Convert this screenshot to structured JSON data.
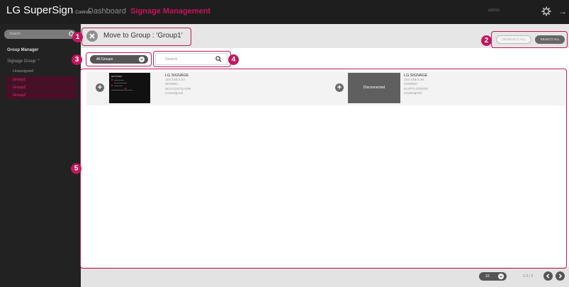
{
  "header": {
    "logo": "LG SuperSign",
    "logo_sub": "Control+",
    "nav": {
      "dashboard": "Dashboard",
      "signage": "Signage Management"
    },
    "user": "admin"
  },
  "sidebar": {
    "search_placeholder": "Search",
    "group_manager": "Group Manager",
    "signage_group": "Signage Group",
    "items": [
      {
        "label": "Unassigned"
      },
      {
        "label": "Group1"
      },
      {
        "label": "Group2"
      },
      {
        "label": "Group3"
      }
    ]
  },
  "dialog": {
    "title": "Move to Group :  'Group1'",
    "deselect_all": "DESELECT ALL",
    "select_all": "SELECT ALL"
  },
  "filter": {
    "group_select": "All Groups",
    "search_placeholder": "Search"
  },
  "devices": [
    {
      "name": "LG SIGNAGE",
      "ip": "192.168.0.24",
      "model": "55SM5C",
      "serial": "5KJY1107QASW",
      "group": "Unassigned",
      "status": "connected"
    },
    {
      "name": "LG SIGNAGE",
      "ip": "192.168.0.36",
      "model": "43SM5D",
      "serial": "612PTLG00029",
      "group": "Unassigned",
      "status": "Disconnected"
    }
  ],
  "thumbnail_text": "NETWORK",
  "pagination": {
    "page_size": "10",
    "page_info": "1-2 /  2"
  },
  "callouts": [
    "1",
    "2",
    "3",
    "4",
    "5"
  ],
  "colors": {
    "accent": "#c2185b",
    "topbar": "#1e1e1e",
    "sidebar": "#222222",
    "selected_group_bg": "#4a0f26"
  }
}
